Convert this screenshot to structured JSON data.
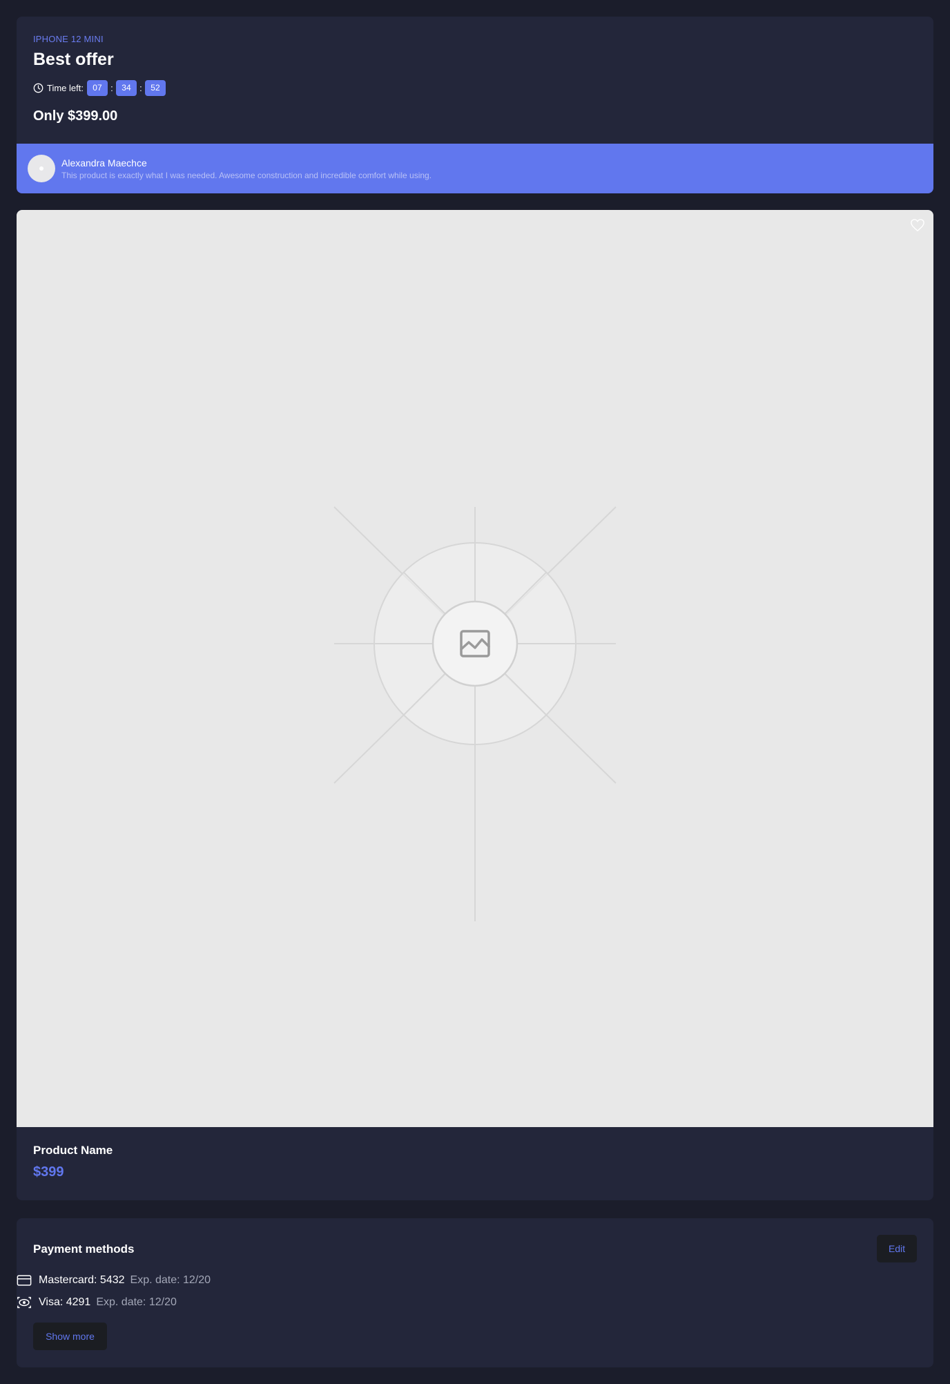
{
  "offer": {
    "eyebrow": "IPHONE 12 MINI",
    "title": "Best offer",
    "timer": {
      "label": "Time left:",
      "hours": "07",
      "minutes": "34",
      "seconds": "52",
      "separator": ":"
    },
    "price": "Only $399.00"
  },
  "review": {
    "name": "Alexandra Maechce",
    "text": "This product is exactly what I was needed. Awesome construction and incredible comfort while using."
  },
  "product": {
    "name": "Product Name",
    "price": "$399",
    "image": "image-placeholder-icon",
    "favorite_icon": "heart-icon"
  },
  "payment": {
    "title": "Payment methods",
    "edit_label": "Edit",
    "methods": [
      {
        "icon": "credit-card-icon",
        "name": "Mastercard: 5432",
        "exp": "Exp. date: 12/20"
      },
      {
        "icon": "visa-card-icon",
        "name": "Visa: 4291",
        "exp": "Exp. date: 12/20"
      }
    ],
    "show_more_label": "Show more"
  },
  "colors": {
    "background": "#1b1d2b",
    "card": "#23263a",
    "accent": "#6177ee",
    "button": "#1b1d22"
  }
}
